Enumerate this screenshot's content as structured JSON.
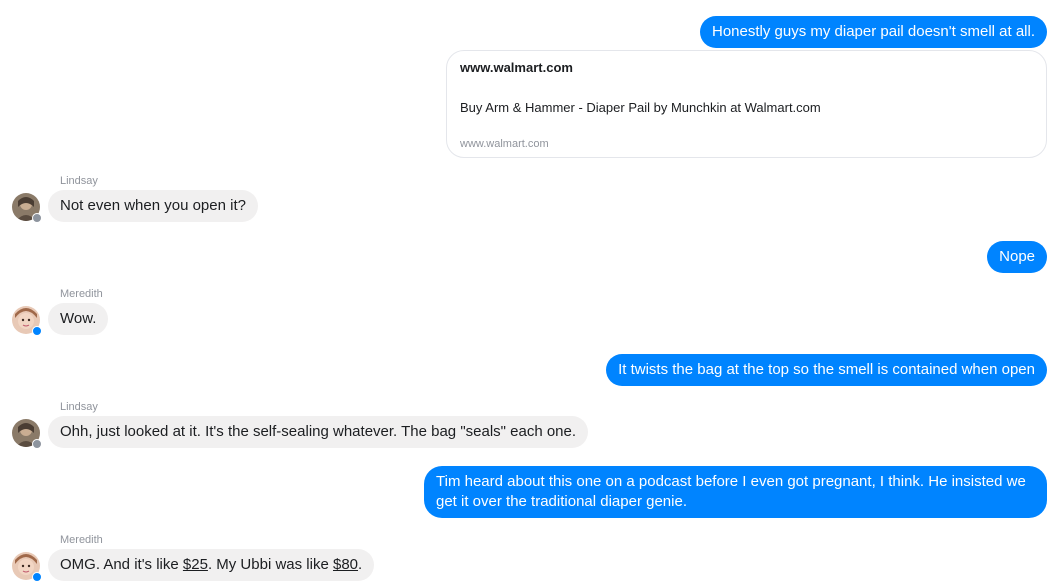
{
  "messages": {
    "m1": {
      "text": "Honestly guys my diaper pail doesn't smell at all."
    },
    "link_card": {
      "title": "www.walmart.com",
      "description": "Buy Arm & Hammer - Diaper Pail by Munchkin at Walmart.com",
      "url": "www.walmart.com"
    },
    "m2": {
      "sender": "Lindsay",
      "text": "Not even when you open it?"
    },
    "m3": {
      "text": "Nope"
    },
    "m4": {
      "sender": "Meredith",
      "text": "Wow."
    },
    "m5": {
      "text": "It twists the bag at the top so the smell is contained when open"
    },
    "m6": {
      "sender": "Lindsay",
      "text": "Ohh, just looked at it. It's the self-sealing whatever. The bag \"seals\" each one."
    },
    "m7": {
      "text": "Tim heard about this one on a podcast before I even got pregnant, I think. He insisted we get it over the traditional diaper genie."
    },
    "m8": {
      "sender": "Meredith",
      "part1": "OMG. And it's like ",
      "price1": "$25",
      "part2": ". My Ubbi was like ",
      "price2": "$80",
      "part3": "."
    }
  },
  "colors": {
    "outgoing_bubble": "#0084ff",
    "incoming_bubble": "#f1f0f0",
    "sender_name": "#90949c",
    "messenger_badge": "#0084ff",
    "facebook_badge": "#8d949e"
  },
  "icons": {
    "lindsay_badge": "facebook-badge-icon",
    "meredith_badge": "messenger-badge-icon"
  }
}
